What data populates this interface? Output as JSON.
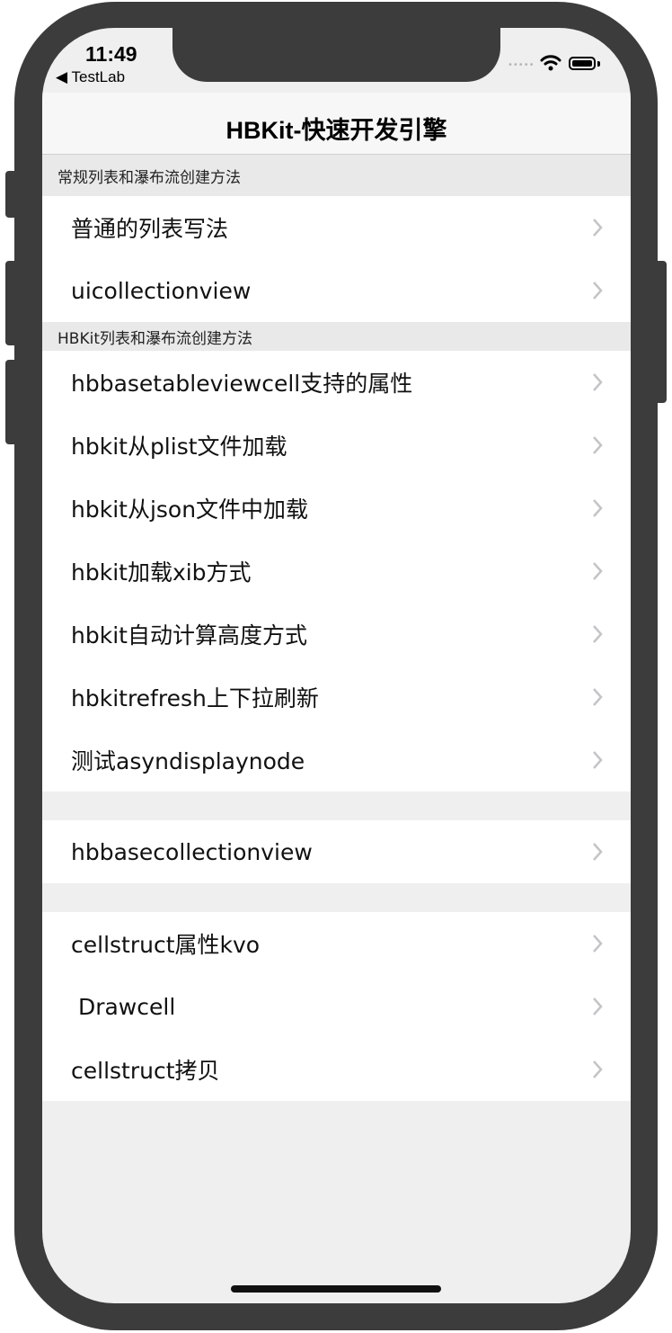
{
  "status_bar": {
    "time": "11:49",
    "back_app": "◀ TestLab",
    "signal_dots": "•••••",
    "wifi_icon": "wifi-icon",
    "battery_icon": "battery-icon"
  },
  "navbar": {
    "title": "HBKit-快速开发引擎"
  },
  "sections": [
    {
      "header": "常规列表和瀑布流创建方法",
      "rows": [
        "普通的列表写法",
        "uicollectionview"
      ]
    },
    {
      "header": "HBKit列表和瀑布流创建方法",
      "rows": [
        "hbbasetableviewcell支持的属性",
        "hbkit从plist文件加载",
        "hbkit从json文件中加载",
        "hbkit加载xib方式",
        "hbkit自动计算高度方式",
        "hbkitrefresh上下拉刷新",
        "测试asyndisplaynode"
      ]
    },
    {
      "header": "",
      "rows": [
        "hbbasecollectionview"
      ]
    },
    {
      "header": "",
      "rows": [
        "cellstruct属性kvo",
        " Drawcell",
        "cellstruct拷贝"
      ]
    }
  ],
  "icons": {
    "row_accessory": "chevron-right-icon"
  },
  "colors": {
    "background": "#efefef",
    "cell": "#ffffff",
    "section_header": "#e9e9e9",
    "chevron": "#c4c4c7",
    "device_frame": "#3c3c3c"
  }
}
